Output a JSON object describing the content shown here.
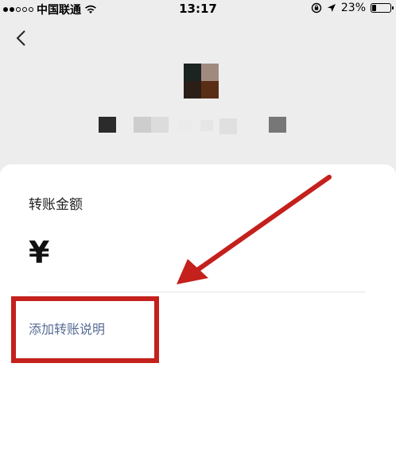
{
  "status_bar": {
    "carrier": "中国联通",
    "time": "13:17",
    "battery_text": "23%",
    "battery_level": 0.23,
    "signal_full": 2,
    "signal_total": 5
  },
  "header": {
    "back_icon": "chevron-left-icon"
  },
  "transfer": {
    "amount_label": "转账金额",
    "currency_symbol": "¥",
    "add_note_label": "添加转账说明"
  },
  "annotation": {
    "color": "#c4201c"
  },
  "colors": {
    "page_bg": "#ededed",
    "card_bg": "#ffffff",
    "link": "#576b95"
  }
}
